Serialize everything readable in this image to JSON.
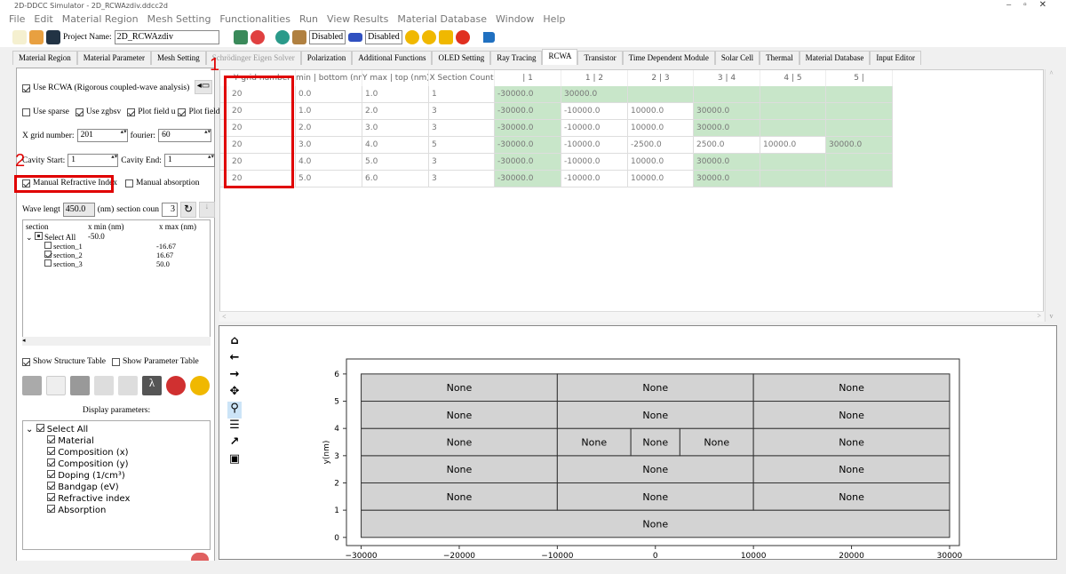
{
  "window": {
    "title": "2D-DDCC Simulator - 2D_RCWAzdiv.ddcc2d"
  },
  "menu": [
    "File",
    "Edit",
    "Material Region",
    "Mesh Setting",
    "Functionalities",
    "Run",
    "View Results",
    "Material Database",
    "Window",
    "Help"
  ],
  "toolbar": {
    "project_label": "Project Name:",
    "project_name": "2D_RCWAzdiv",
    "disabled1": "Disabled",
    "disabled2": "Disabled"
  },
  "tabs": [
    "Material Region",
    "Material Parameter",
    "Mesh Setting",
    "Schrödinger Eigen Solver",
    "Polarization",
    "Additional Functions",
    "OLED Setting",
    "Ray Tracing",
    "RCWA",
    "Transistor",
    "Time Dependent Module",
    "Solar Cell",
    "Thermal",
    "Material Database",
    "Input Editor"
  ],
  "active_tab": "RCWA",
  "left": {
    "use_rcwa": "Use RCWA (Rigorous coupled-wave analysis)",
    "use_sparse": "Use sparse",
    "use_zgbsv": "Use zgbsv",
    "plot_field_u": "Plot field u",
    "plot_field_d": "Plot field d",
    "x_grid_label": "X grid number:",
    "x_grid": "201",
    "fourier_label": "fourier:",
    "fourier": "60",
    "cavity_start_label": "Cavity Start:",
    "cavity_start": "1",
    "cavity_end_label": "Cavity End:",
    "cavity_end": "1",
    "manual_ri": "Manual Refractive Index",
    "manual_abs": "Manual absorption",
    "wave_label": "Wave lengt",
    "wave": "450.0",
    "nm": "(nm)",
    "section_count_label": "section coun",
    "section_count": "3",
    "sections_tree": {
      "headers": [
        "section",
        "x min (nm)",
        "x max (nm)"
      ],
      "select_all": "Select All",
      "select_all_min": "-50.0",
      "items": [
        {
          "name": "section_1",
          "checked": false,
          "max": "-16.67"
        },
        {
          "name": "section_2",
          "checked": true,
          "max": "16.67"
        },
        {
          "name": "section_3",
          "checked": false,
          "max": "50.0"
        }
      ]
    },
    "show_structure": "Show Structure Table",
    "show_parameter": "Show Parameter Table",
    "display_params_label": "Display parameters:",
    "display_params": {
      "select_all": "Select All",
      "items": [
        "Material",
        "Composition (x)",
        "Composition (y)",
        "Doping (1/cm³)",
        "Bandgap (eV)",
        "Refractive index",
        "Absorption"
      ]
    }
  },
  "table": {
    "headers": [
      "Y grid number",
      "min | bottom (nr",
      "Y max | top (nm)",
      "X Section Count",
      "| 1",
      "1 | 2",
      "2 | 3",
      "3 | 4",
      "4 | 5",
      "5 |"
    ],
    "rows": [
      [
        "20",
        "0.0",
        "1.0",
        "1",
        "-30000.0",
        "30000.0",
        "",
        "",
        "",
        ""
      ],
      [
        "20",
        "1.0",
        "2.0",
        "3",
        "-30000.0",
        "-10000.0",
        "10000.0",
        "30000.0",
        "",
        ""
      ],
      [
        "20",
        "2.0",
        "3.0",
        "3",
        "-30000.0",
        "-10000.0",
        "10000.0",
        "30000.0",
        "",
        ""
      ],
      [
        "20",
        "3.0",
        "4.0",
        "5",
        "-30000.0",
        "-10000.0",
        "-2500.0",
        "2500.0",
        "10000.0",
        "30000.0"
      ],
      [
        "20",
        "4.0",
        "5.0",
        "3",
        "-30000.0",
        "-10000.0",
        "10000.0",
        "30000.0",
        "",
        ""
      ],
      [
        "20",
        "5.0",
        "6.0",
        "3",
        "-30000.0",
        "-10000.0",
        "10000.0",
        "30000.0",
        "",
        ""
      ]
    ],
    "highlight_color": "#c8e6c9"
  },
  "annotations": {
    "label1": "1",
    "label2": "2",
    "color": "#e00000"
  },
  "plot_nav": [
    "home-icon",
    "back-icon",
    "forward-icon",
    "pan-icon",
    "zoom-icon",
    "configure-icon",
    "edit-axes-icon",
    "save-icon"
  ],
  "chart_data": {
    "type": "rectangles",
    "ylabel": "y(nm)",
    "xlabel": "",
    "xlim": [
      -31500,
      31000
    ],
    "ylim": [
      -0.3,
      6.55
    ],
    "xticks": [
      -30000,
      -20000,
      -10000,
      0,
      10000,
      20000,
      30000
    ],
    "xtick_labels": [
      "−30000",
      "−20000",
      "−10000",
      "0",
      "10000",
      "20000",
      "30000"
    ],
    "yticks": [
      0,
      1,
      2,
      3,
      4,
      5,
      6
    ],
    "region_label": "None",
    "fill": "#d3d3d3"
  }
}
